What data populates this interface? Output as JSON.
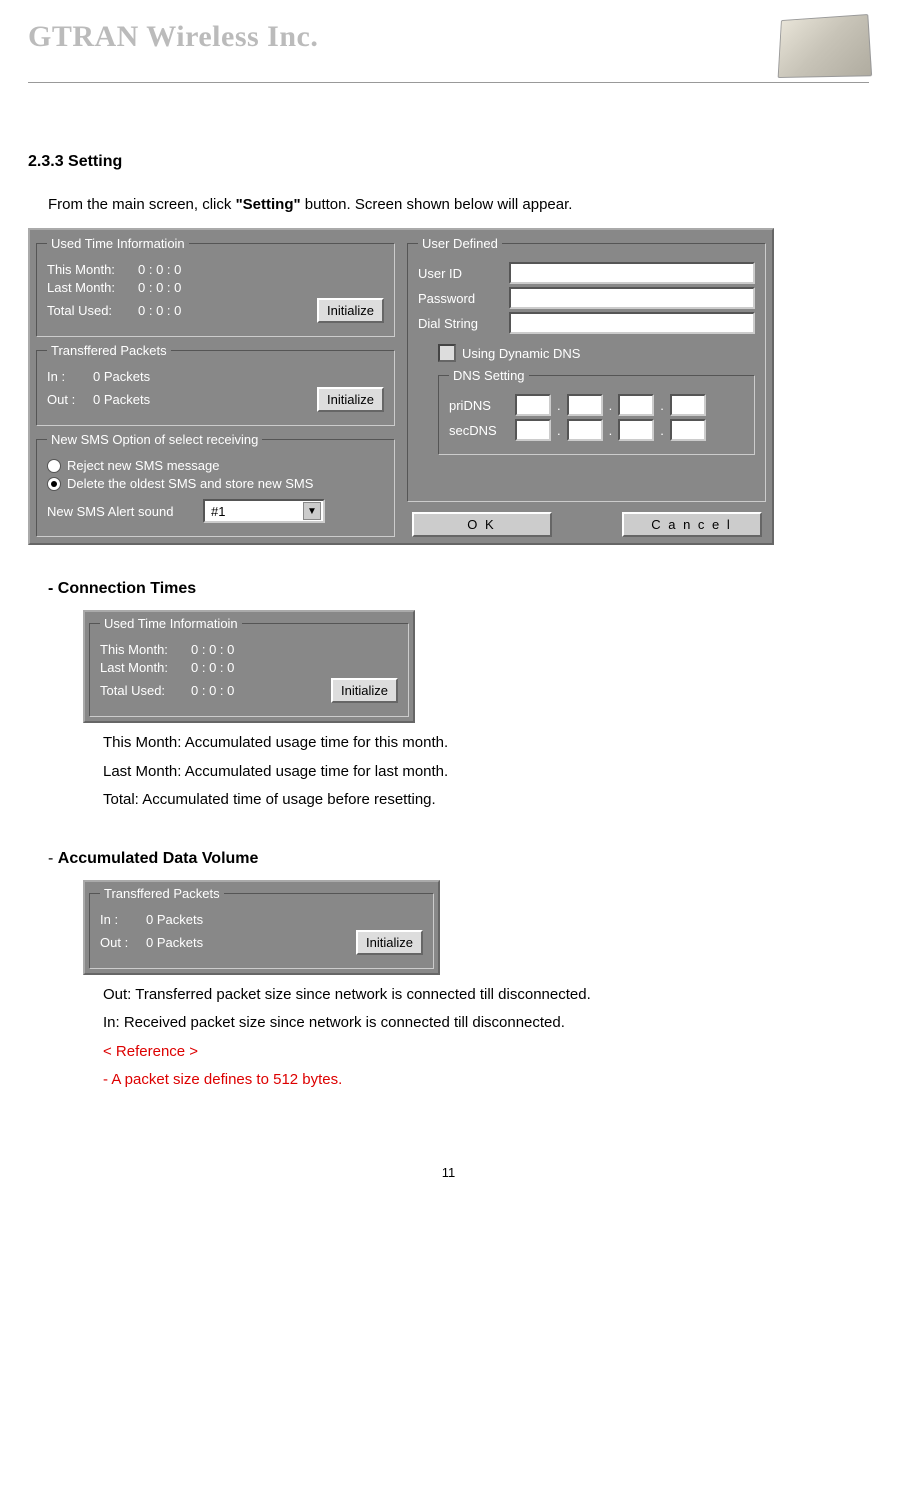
{
  "header": {
    "company": "GTRAN Wireless Inc."
  },
  "section": {
    "number": "2.3.3 Setting",
    "intro_pre": "From the main screen, click ",
    "intro_bold": "\"Setting\"",
    "intro_post": " button. Screen shown below will appear."
  },
  "dialog_main": {
    "used_time": {
      "legend": "Used Time Informatioin",
      "this_month_label": "This Month:",
      "this_month_value": "0 : 0 : 0",
      "last_month_label": "Last Month:",
      "last_month_value": "0 : 0 : 0",
      "total_label": "Total Used:",
      "total_value": "0 : 0 : 0",
      "initialize": "Initialize"
    },
    "packets": {
      "legend": "Transffered Packets",
      "in_label": "In :",
      "in_value": "0 Packets",
      "out_label": "Out :",
      "out_value": "0 Packets",
      "initialize": "Initialize"
    },
    "sms": {
      "legend": "New SMS Option of select receiving",
      "opt1": "Reject new SMS message",
      "opt2": "Delete the oldest SMS and store new SMS",
      "alert_label": "New SMS Alert sound",
      "alert_value": "#1"
    },
    "user_defined": {
      "legend": "User Defined",
      "user_id": "User ID",
      "password": "Password",
      "dial_string": "Dial String",
      "dyn_dns": "Using Dynamic DNS",
      "dns_legend": "DNS Setting",
      "pridns": "priDNS",
      "secdns": "secDNS"
    },
    "ok": "O       K",
    "cancel": "C a n c e l"
  },
  "connection_times": {
    "heading": "- Connection Times",
    "this_month": "This Month: Accumulated usage time for this month.",
    "last_month": "Last Month: Accumulated usage time for last month.",
    "total": "Total: Accumulated time of usage before resetting."
  },
  "data_volume": {
    "heading_prefix": "- ",
    "heading_bold": "Accumulated Data Volume",
    "out": "Out: Transferred packet size since network is connected till disconnected.",
    "in": "In: Received packet size since network is connected till disconnected.",
    "ref": "< Reference >",
    "packet_def": "- A packet size defines to 512 bytes."
  },
  "page_number": "11"
}
